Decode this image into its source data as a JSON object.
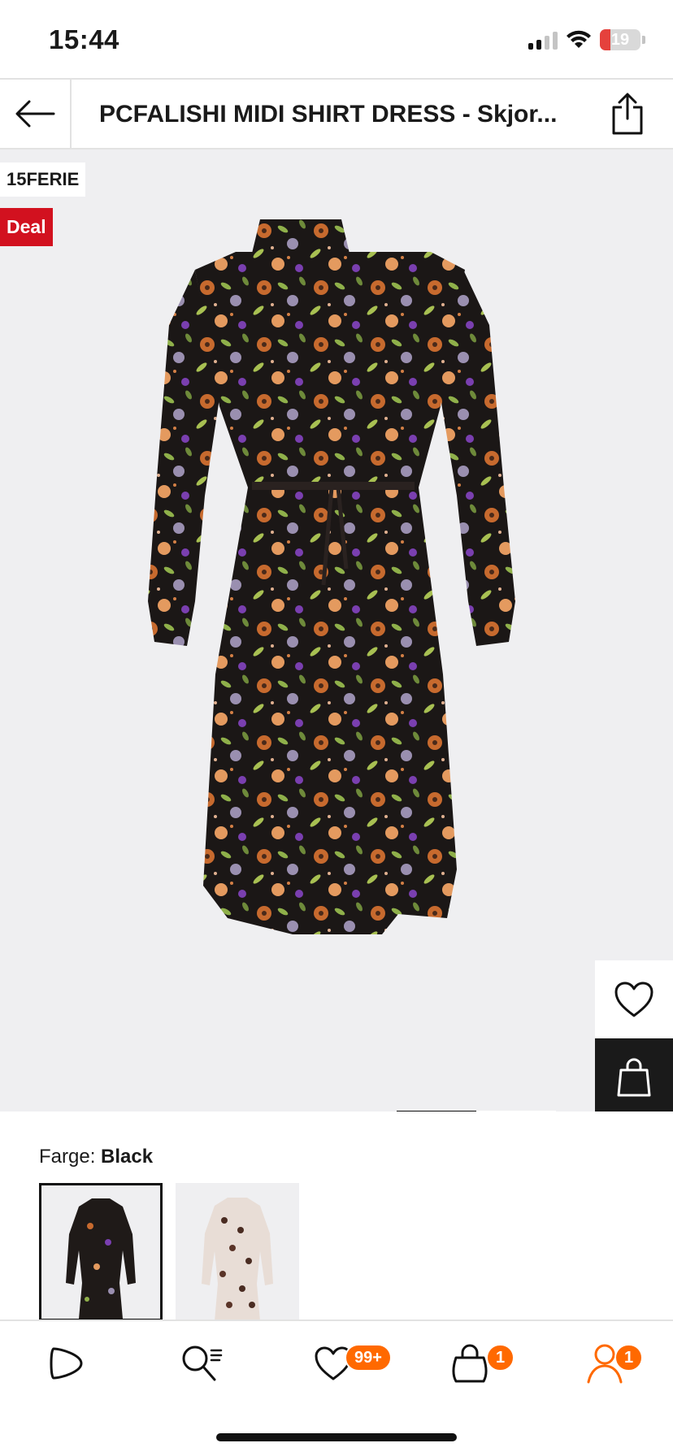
{
  "status_bar": {
    "time": "15:44",
    "battery": "19",
    "icons": [
      "signal-icon",
      "wifi-icon",
      "battery-icon"
    ]
  },
  "header": {
    "back_icon": "arrow-left-icon",
    "title": "PCFALISHI MIDI SHIRT DRESS - Skjor...",
    "share_icon": "share-icon"
  },
  "product": {
    "badges": {
      "promo": "15FERIE",
      "deal": "Deal"
    },
    "image_alt": "floral black shirt dress",
    "carousel": {
      "active_index": 1,
      "total": 2
    },
    "actions": {
      "wishlist_icon": "heart-icon",
      "bag_icon": "shopping-bag-icon"
    }
  },
  "color": {
    "label": "Farge:",
    "value": "Black",
    "swatches": [
      "black-floral",
      "brown-white-print"
    ]
  },
  "tabbar": {
    "items": [
      {
        "name": "home",
        "icon": "zalando-play-icon"
      },
      {
        "name": "search",
        "icon": "search-list-icon"
      },
      {
        "name": "wishlist",
        "icon": "heart-icon",
        "badge": "99+"
      },
      {
        "name": "cart",
        "icon": "shopping-bag-icon",
        "badge": "1"
      },
      {
        "name": "account",
        "icon": "user-icon",
        "badge": "1"
      }
    ]
  },
  "colors": {
    "accent": "#ff6900",
    "deal": "#d2111f",
    "image_bg": "#efeff1"
  }
}
